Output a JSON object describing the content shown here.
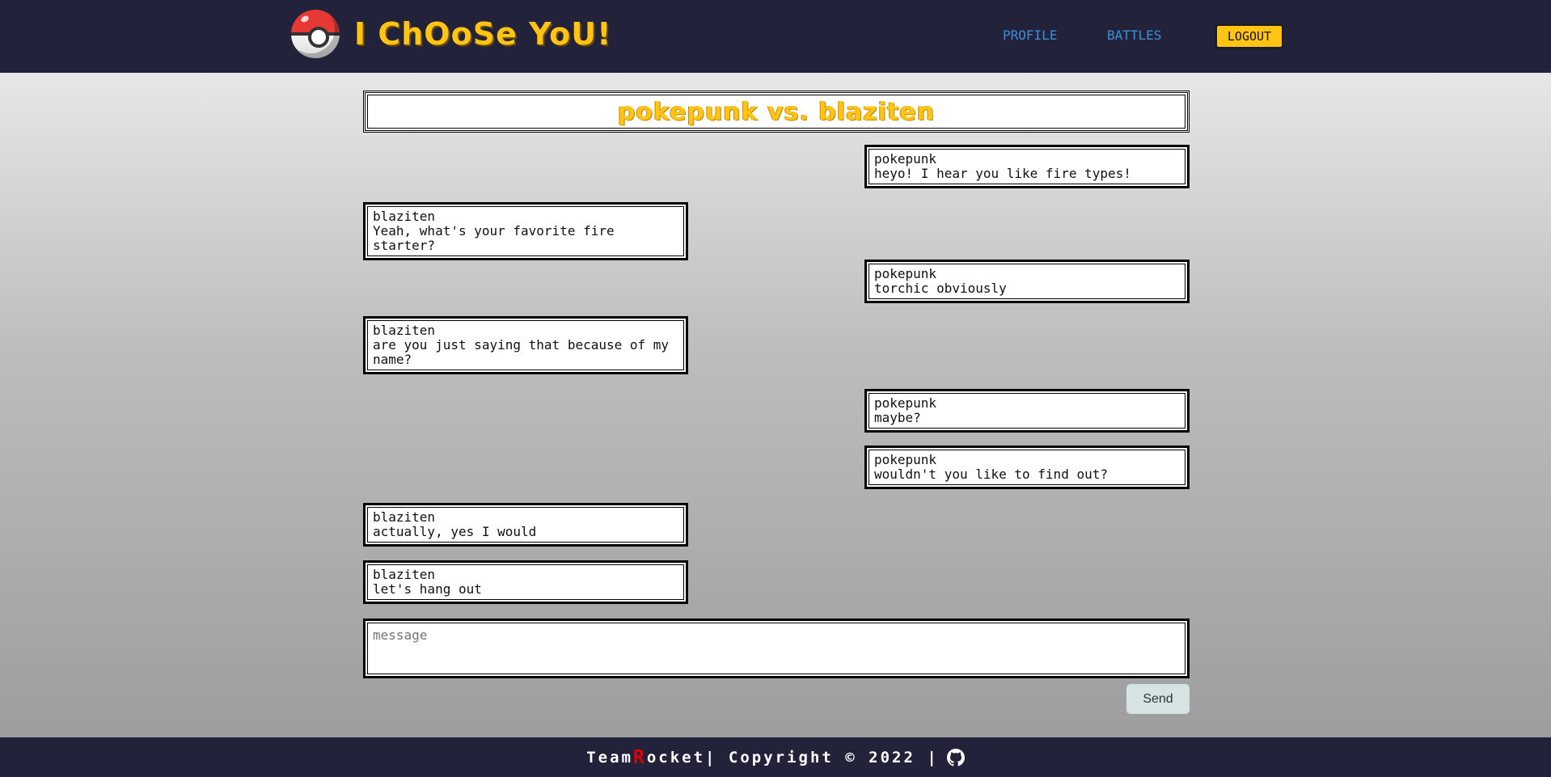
{
  "header": {
    "brand_title": "I ChOoSe YoU!",
    "nav": [
      {
        "label": "PROFILE"
      },
      {
        "label": "BATTLES"
      }
    ],
    "logout_label": "LOGOUT",
    "colors": {
      "bg": "#23223b",
      "accent": "#ffc414",
      "link": "#3b8fd6"
    }
  },
  "chat": {
    "title": "pokepunk vs. blaziten",
    "messages": [
      {
        "side": "right",
        "author": "pokepunk",
        "text": "heyo! I hear you like fire types!"
      },
      {
        "side": "left",
        "author": "blaziten",
        "text": "Yeah, what's your favorite fire starter?"
      },
      {
        "side": "right",
        "author": "pokepunk",
        "text": "torchic obviously"
      },
      {
        "side": "left",
        "author": "blaziten",
        "text": "are you just saying that because of my name?"
      },
      {
        "side": "right",
        "author": "pokepunk",
        "text": "maybe?"
      },
      {
        "side": "right",
        "author": "pokepunk",
        "text": "wouldn't you like to find out?"
      },
      {
        "side": "left",
        "author": "blaziten",
        "text": "actually, yes I would"
      },
      {
        "side": "left",
        "author": "blaziten",
        "text": "let's hang out"
      }
    ],
    "input_placeholder": "message",
    "send_label": "Send"
  },
  "footer": {
    "team_prefix": "Team ",
    "r_letter": "R",
    "team_suffix": "ocket",
    "copyright": " | Copyright © 2022 | ",
    "github_icon": "github-icon"
  }
}
